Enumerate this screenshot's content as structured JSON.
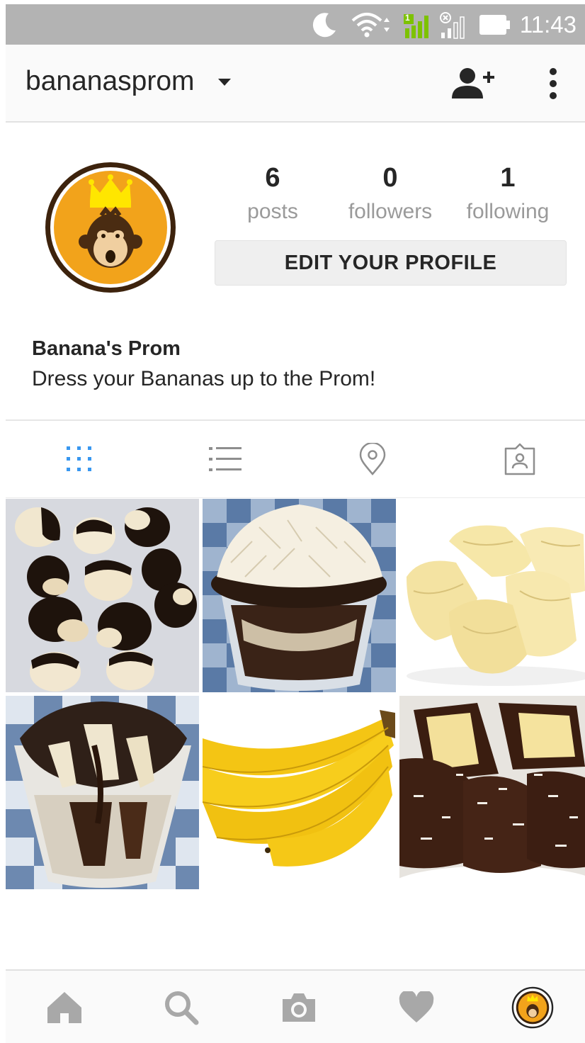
{
  "status_bar": {
    "time": "11:43",
    "sim_badge": "1",
    "icons": [
      "moon-icon",
      "wifi-icon",
      "signal-sim1-icon",
      "signal-sim2-icon",
      "battery-icon"
    ],
    "background": "#b3b3b3"
  },
  "header": {
    "username": "bananasprom",
    "icons": [
      "chevron-down-icon",
      "add-user-icon",
      "more-vert-icon"
    ]
  },
  "profile": {
    "stats": [
      {
        "value": "6",
        "label": "posts"
      },
      {
        "value": "0",
        "label": "followers"
      },
      {
        "value": "1",
        "label": "following"
      }
    ],
    "edit_button_label": "EDIT YOUR PROFILE",
    "display_name": "Banana's Prom",
    "bio": "Dress your Bananas up to the Prom!",
    "avatar_colors": {
      "ring": "#4a2c12",
      "fill": "#f2a31b"
    }
  },
  "view_tabs": [
    {
      "icon": "grid-icon",
      "active": true
    },
    {
      "icon": "list-icon",
      "active": false
    },
    {
      "icon": "location-pin-icon",
      "active": false
    },
    {
      "icon": "tagged-photos-icon",
      "active": false
    }
  ],
  "accent_color": "#3897f0",
  "posts": [
    {
      "subject": "chocolate-dipped banana slices"
    },
    {
      "subject": "banana dessert cup with shredded cheese"
    },
    {
      "subject": "peeled banana pieces"
    },
    {
      "subject": "banana dessert cup with cookie crumbs"
    },
    {
      "subject": "bunch of bananas"
    },
    {
      "subject": "chocolate coconut banana bites"
    }
  ],
  "bottom_nav": [
    "home-icon",
    "search-icon",
    "camera-icon",
    "heart-icon",
    "profile-avatar-icon"
  ]
}
